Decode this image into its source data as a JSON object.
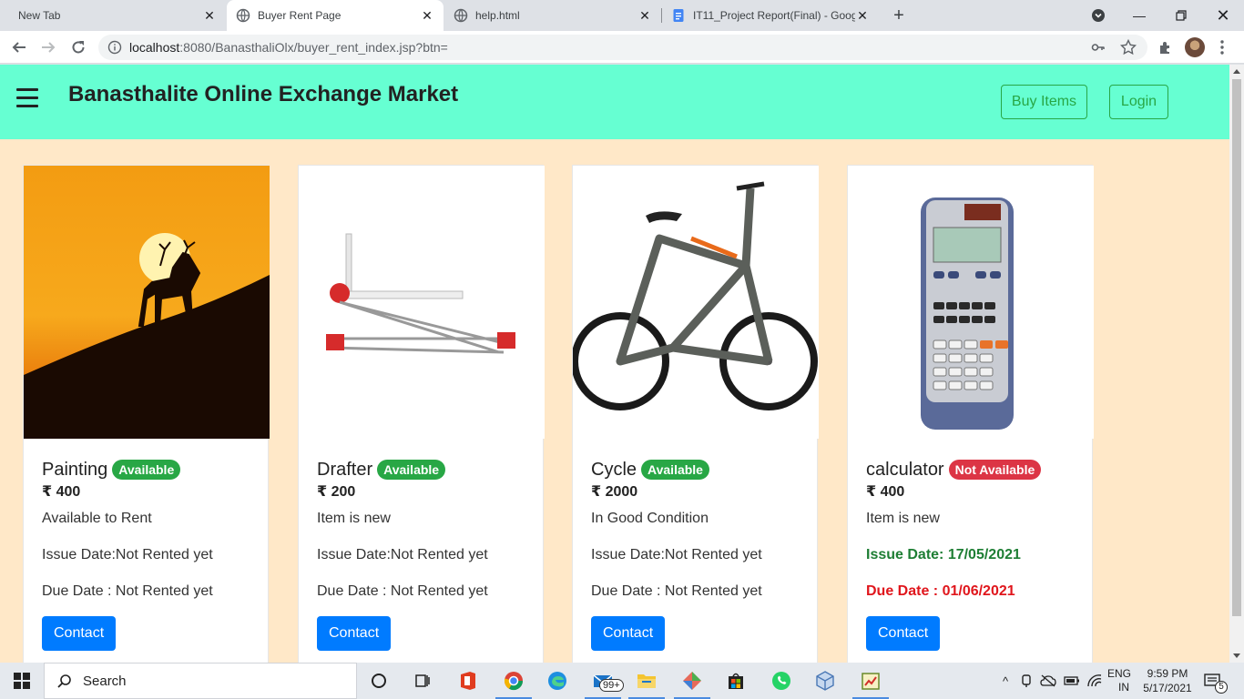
{
  "browser": {
    "tabs": [
      {
        "title": "New Tab",
        "active": false
      },
      {
        "title": "Buyer Rent Page",
        "active": true
      },
      {
        "title": "help.html",
        "active": false
      },
      {
        "title": "IT11_Project Report(Final) - Goog",
        "active": false
      }
    ],
    "url_host": "localhost",
    "url_path": ":8080/BanasthaliOlx/buyer_rent_index.jsp?btn="
  },
  "page": {
    "brand": "Banasthalite Online Exchange Market",
    "nav": {
      "buy_items": "Buy Items",
      "login": "Login"
    },
    "contact_label": "Contact",
    "items": [
      {
        "name": "Painting",
        "status": "Available",
        "price": "₹ 400",
        "desc": "Available to Rent",
        "issue": "Issue Date:Not Rented yet",
        "due": "Due Date : Not Rented yet"
      },
      {
        "name": "Drafter",
        "status": "Available",
        "price": "₹ 200",
        "desc": "Item is new",
        "issue": "Issue Date:Not Rented yet",
        "due": "Due Date : Not Rented yet"
      },
      {
        "name": "Cycle",
        "status": "Available",
        "price": "₹ 2000",
        "desc": "In Good Condition",
        "issue": "Issue Date:Not Rented yet",
        "due": "Due Date : Not Rented yet"
      },
      {
        "name": "calculator",
        "status": "Not Available",
        "price": "₹ 400",
        "desc": "Item is new",
        "issue": "Issue Date: 17/05/2021",
        "due": "Due Date : 01/06/2021"
      }
    ],
    "colors": {
      "navbar": "#66ffd2",
      "background": "#ffe8c8",
      "available": "#28a745",
      "not_available": "#dc3545",
      "button": "#007bff"
    }
  },
  "taskbar": {
    "search_label": "Search",
    "mail_badge": "99+",
    "lang_top": "ENG",
    "lang_bottom": "IN",
    "time": "9:59 PM",
    "date": "5/17/2021",
    "notif_count": "5"
  }
}
